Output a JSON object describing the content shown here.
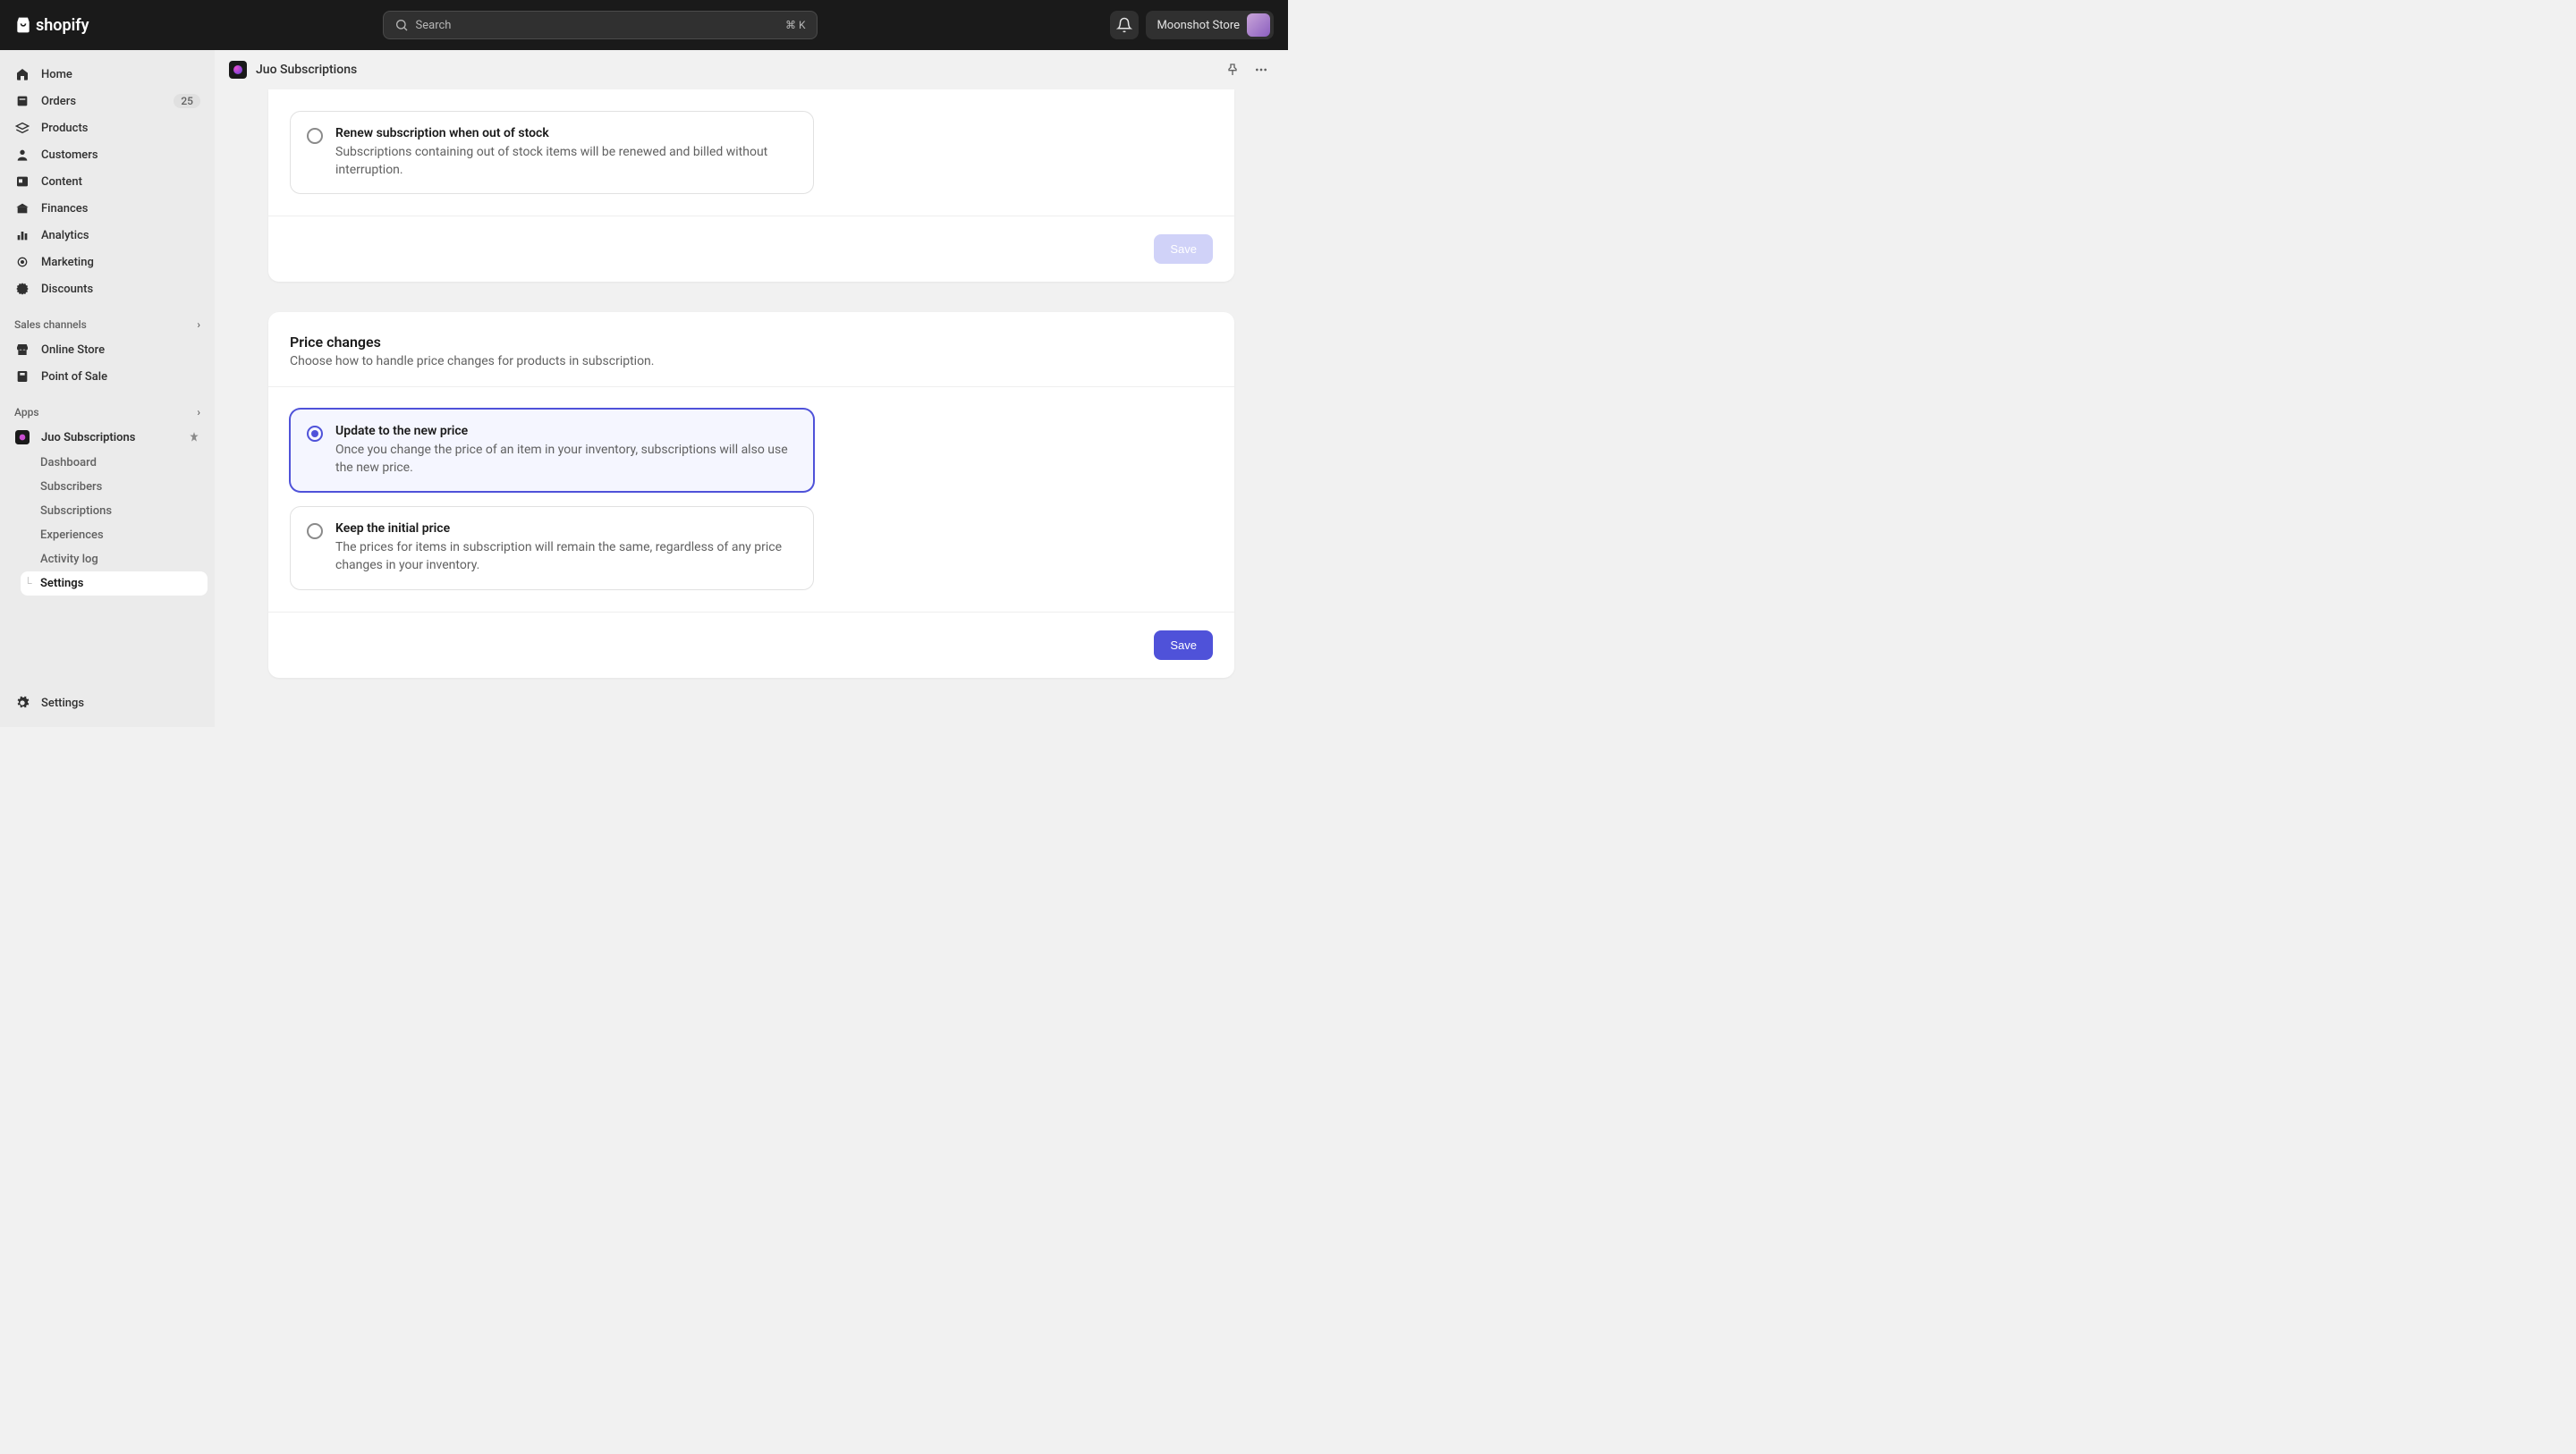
{
  "topbar": {
    "logo_text": "shopify",
    "search_placeholder": "Search",
    "search_kbd": "⌘ K",
    "store_name": "Moonshot Store"
  },
  "sidebar": {
    "primary": [
      {
        "label": "Home",
        "icon": "home"
      },
      {
        "label": "Orders",
        "icon": "orders",
        "badge": "25"
      },
      {
        "label": "Products",
        "icon": "products"
      },
      {
        "label": "Customers",
        "icon": "customers"
      },
      {
        "label": "Content",
        "icon": "content"
      },
      {
        "label": "Finances",
        "icon": "finances"
      },
      {
        "label": "Analytics",
        "icon": "analytics"
      },
      {
        "label": "Marketing",
        "icon": "marketing"
      },
      {
        "label": "Discounts",
        "icon": "discounts"
      }
    ],
    "sales_channels_label": "Sales channels",
    "sales_channels": [
      {
        "label": "Online Store",
        "icon": "online-store"
      },
      {
        "label": "Point of Sale",
        "icon": "pos"
      }
    ],
    "apps_label": "Apps",
    "app_pinned": {
      "label": "Juo Subscriptions"
    },
    "app_sub": [
      {
        "label": "Dashboard"
      },
      {
        "label": "Subscribers"
      },
      {
        "label": "Subscriptions"
      },
      {
        "label": "Experiences"
      },
      {
        "label": "Activity log"
      },
      {
        "label": "Settings",
        "active": true
      }
    ],
    "footer_settings": "Settings"
  },
  "page": {
    "title": "Juo Subscriptions"
  },
  "card_stock": {
    "option": {
      "title": "Renew subscription when out of stock",
      "desc": "Subscriptions containing out of stock items will be renewed and billed without interruption.",
      "selected": false
    },
    "save": "Save"
  },
  "card_price": {
    "title": "Price changes",
    "desc": "Choose how to handle price changes for products in subscription.",
    "options": [
      {
        "title": "Update to the new price",
        "desc": "Once you change the price of an item in your inventory, subscriptions will also use the new price.",
        "selected": true
      },
      {
        "title": "Keep the initial price",
        "desc": "The prices for items in subscription will remain the same, regardless of any price changes in your inventory.",
        "selected": false
      }
    ],
    "save": "Save"
  }
}
